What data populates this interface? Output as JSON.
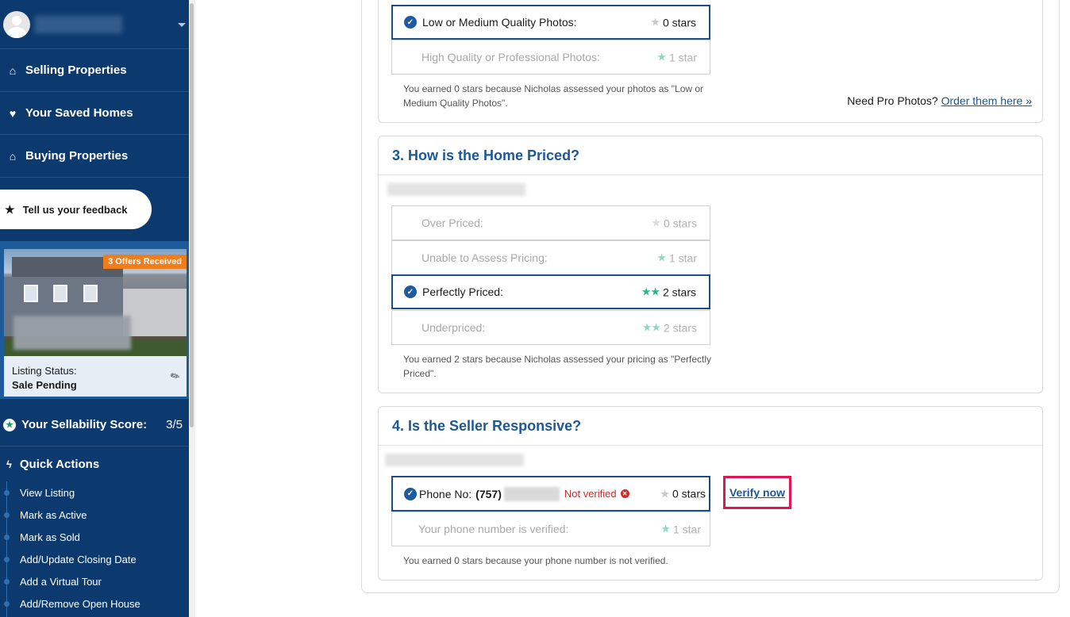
{
  "sidebar": {
    "nav": [
      {
        "label": "Selling Properties",
        "icon": "home-icon"
      },
      {
        "label": "Your Saved Homes",
        "icon": "heart-icon"
      },
      {
        "label": "Buying Properties",
        "icon": "home-icon"
      }
    ],
    "feedback": {
      "label": "Tell us your feedback",
      "icon": "star-icon"
    },
    "listing": {
      "badge": "3 Offers Received",
      "status_label": "Listing Status:",
      "status_value": "Sale Pending"
    },
    "score": {
      "label": "Your Sellability Score:",
      "value": "3/5"
    },
    "quick_actions": {
      "title": "Quick Actions",
      "items": [
        "View Listing",
        "Mark as Active",
        "Mark as Sold",
        "Add/Update Closing Date",
        "Add a Virtual Tour",
        "Add/Remove Open House"
      ]
    }
  },
  "photos": {
    "options": [
      {
        "label": "Low or Medium Quality Photos:",
        "stars": "0 stars",
        "selected": true
      },
      {
        "label": "High Quality or Professional Photos:",
        "stars": "1 star",
        "selected": false
      }
    ],
    "note": "You earned 0 stars because Nicholas assessed your photos as \"Low or Medium Quality Photos\".",
    "pro_prompt": "Need Pro Photos?",
    "pro_link": "Order them here"
  },
  "pricing": {
    "title": "3. How is the Home Priced?",
    "options": [
      {
        "label": "Over Priced:",
        "stars": "0 stars",
        "selected": false
      },
      {
        "label": "Unable to Assess Pricing:",
        "stars": "1 star",
        "selected": false
      },
      {
        "label": "Perfectly Priced:",
        "stars": "2 stars",
        "selected": true
      },
      {
        "label": "Underpriced:",
        "stars": "2 stars",
        "selected": false
      }
    ],
    "note": "You earned 2 stars because Nicholas assessed your pricing as \"Perfectly Priced\"."
  },
  "responsive": {
    "title": "4. Is the Seller Responsive?",
    "phone_label": "Phone No:",
    "phone_prefix": "(757)",
    "not_verified": "Not verified",
    "phone_stars": "0 stars",
    "verified_label": "Your phone number is verified:",
    "verified_stars": "1 star",
    "verify_link": "Verify now",
    "note": "You earned 0 stars because your phone number is not verified."
  },
  "colors": {
    "sidebar": "#0d3a6e",
    "accent": "#1c5896",
    "star_green": "#2bb58a",
    "star_gray": "#c8c8c8",
    "highlight": "#e21553",
    "badge": "#f07d1c"
  }
}
